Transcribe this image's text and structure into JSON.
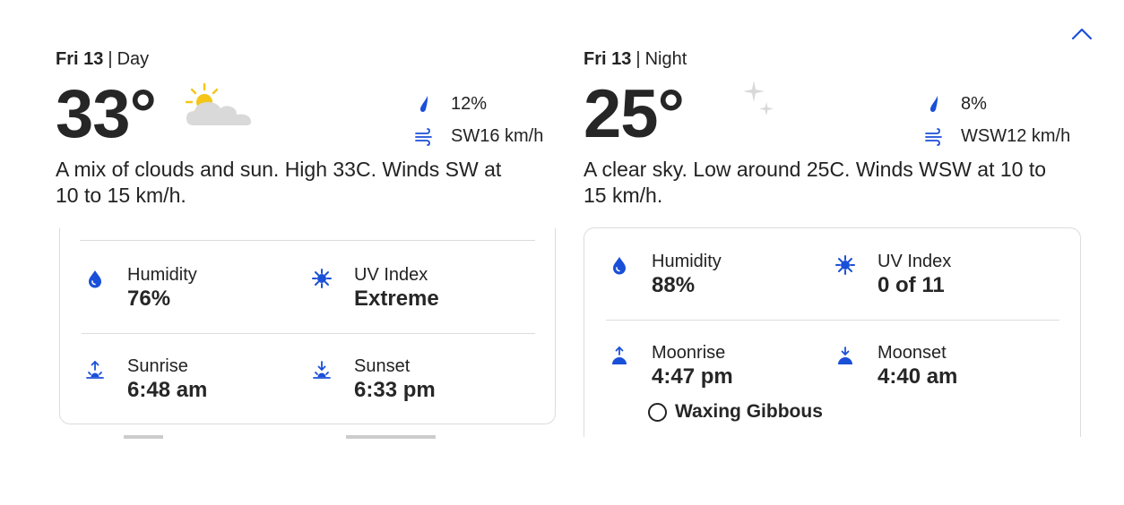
{
  "day": {
    "date": "Fri 13",
    "period": "Day",
    "temperature": "33°",
    "icon": "partly-sunny-icon",
    "precip": "12%",
    "wind": "SW16 km/h",
    "description": "A mix of clouds and sun. High 33C. Winds SW at 10 to 15 km/h.",
    "humidity_label": "Humidity",
    "humidity_value": "76%",
    "uv_label": "UV Index",
    "uv_value": "Extreme",
    "sunrise_label": "Sunrise",
    "sunrise_value": "6:48 am",
    "sunset_label": "Sunset",
    "sunset_value": "6:33 pm"
  },
  "night": {
    "date": "Fri 13",
    "period": "Night",
    "temperature": "25°",
    "icon": "clear-night-icon",
    "precip": "8%",
    "wind": "WSW12 km/h",
    "description": "A clear sky. Low around 25C. Winds WSW at 10 to 15 km/h.",
    "humidity_label": "Humidity",
    "humidity_value": "88%",
    "uv_label": "UV Index",
    "uv_value": "0 of 11",
    "moonrise_label": "Moonrise",
    "moonrise_value": "4:47 pm",
    "moonset_label": "Moonset",
    "moonset_value": "4:40 am",
    "moon_phase": "Waxing Gibbous"
  },
  "separator": "|",
  "colors": {
    "accent": "#1a4fd8",
    "text": "#222222",
    "border": "#dcdcdc",
    "icon_gray": "#d9d9d9",
    "sun": "#f5c518"
  }
}
